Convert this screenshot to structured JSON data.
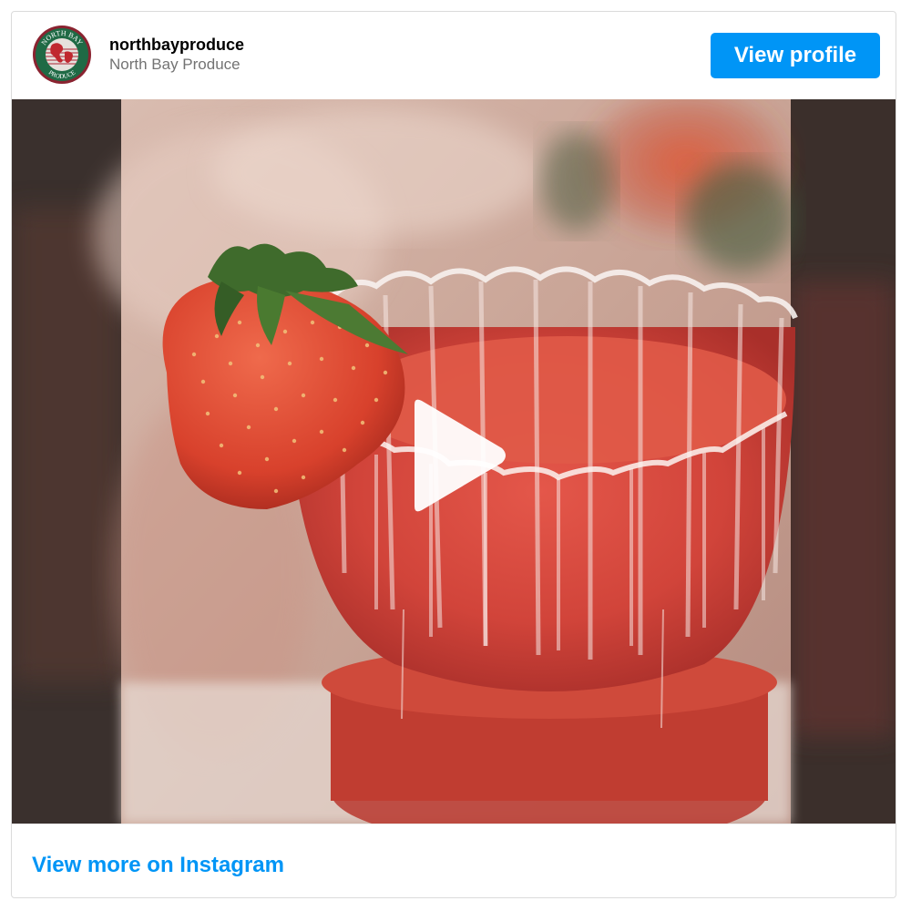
{
  "header": {
    "username": "northbayproduce",
    "full_name": "North Bay Produce",
    "view_profile_label": "View profile",
    "avatar_icon": "north-bay-produce-logo",
    "avatar_text_top": "NORTH BAY",
    "avatar_text_bottom": "PRODUCE"
  },
  "media": {
    "type": "video",
    "play_icon": "play-icon"
  },
  "footer": {
    "link_label": "View more on Instagram"
  },
  "colors": {
    "accent": "#0095f6",
    "secondary_text": "#737373",
    "border": "#dbdbdb"
  }
}
